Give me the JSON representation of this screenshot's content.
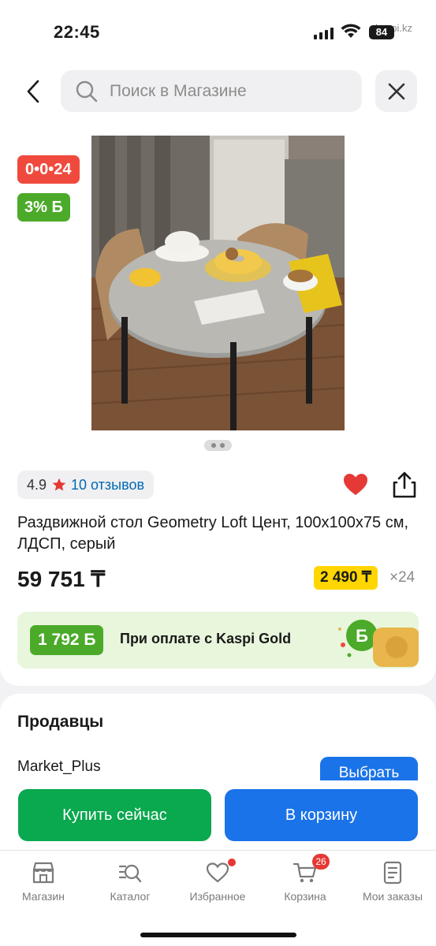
{
  "status_bar": {
    "time": "22:45",
    "battery": "84",
    "watermark": "kaspi.kz"
  },
  "search": {
    "placeholder": "Поиск в Магазине"
  },
  "product": {
    "timer_badge": "0•0•24",
    "bonus_badge": "3% Б",
    "rating": "4.9",
    "reviews": "10 отзывов",
    "title": "Раздвижной стол Geometry Loft Цент, 100x100x75 см, ЛДСП, серый",
    "price": "59 751 ₸",
    "installment": "2 490 ₸",
    "installment_mult": "×24",
    "image_pages": 2,
    "favorited": true
  },
  "kaspi_gold": {
    "bonus": "1 792 Б",
    "text": "При оплате с Kaspi Gold"
  },
  "sellers": {
    "title": "Продавцы",
    "seller_name": "Market_Plus",
    "choose_label": "Выбрать"
  },
  "actions": {
    "buy_now": "Купить сейчас",
    "to_cart": "В корзину"
  },
  "tabs": [
    {
      "label": "Магазин",
      "icon": "store-icon"
    },
    {
      "label": "Каталог",
      "icon": "catalog-icon"
    },
    {
      "label": "Избранное",
      "icon": "heart-icon"
    },
    {
      "label": "Корзина",
      "icon": "cart-icon",
      "badge": "26"
    },
    {
      "label": "Мои заказы",
      "icon": "orders-icon"
    }
  ],
  "colors": {
    "accent_blue": "#1a73e8",
    "buy_green": "#0aa84f",
    "badge_red": "#f04a3e",
    "bonus_green": "#4caa2a",
    "installment_yellow": "#ffd600"
  }
}
